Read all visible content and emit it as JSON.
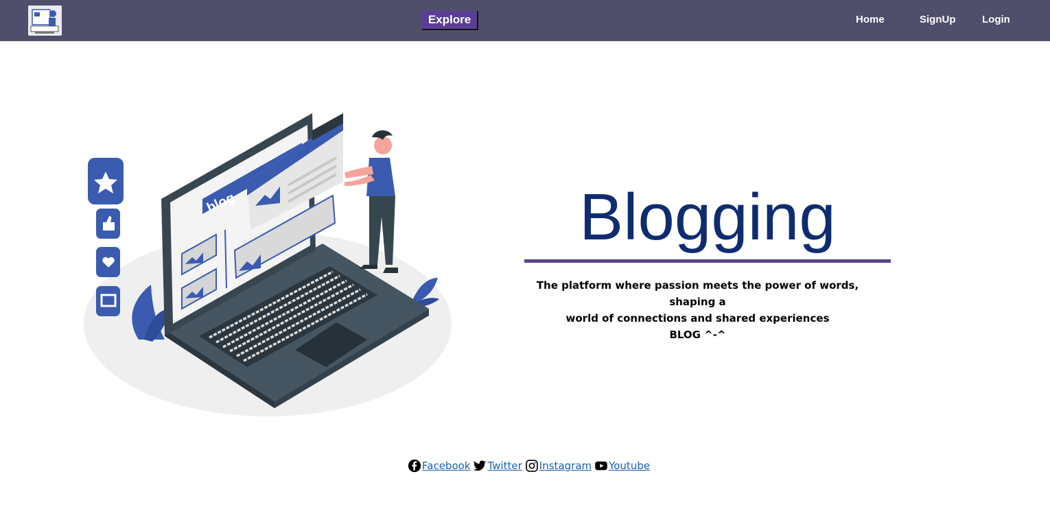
{
  "navbar": {
    "explore_label": "Explore",
    "links": [
      {
        "label": "Home"
      },
      {
        "label": "SignUp"
      },
      {
        "label": "Login"
      }
    ]
  },
  "illustration": {
    "screen_label": "blog"
  },
  "hero": {
    "title": "Blogging",
    "tagline_line1": "The platform where passion meets the power of words, shaping a",
    "tagline_line2": "world of connections and shared experiences",
    "tagline_line3": "BLOG ^-^"
  },
  "social": [
    {
      "label": "Facebook",
      "icon": "facebook-icon"
    },
    {
      "label": "Twitter",
      "icon": "twitter-icon"
    },
    {
      "label": "Instagram",
      "icon": "instagram-icon"
    },
    {
      "label": "Youtube",
      "icon": "youtube-icon"
    }
  ],
  "colors": {
    "navbar_bg": "#4f4e6b",
    "explore_bg": "#5a3e96",
    "title": "#0f2c70",
    "divider": "#5a4287",
    "link": "#1a5fb4",
    "illustration_accent": "#3a5bb0"
  }
}
